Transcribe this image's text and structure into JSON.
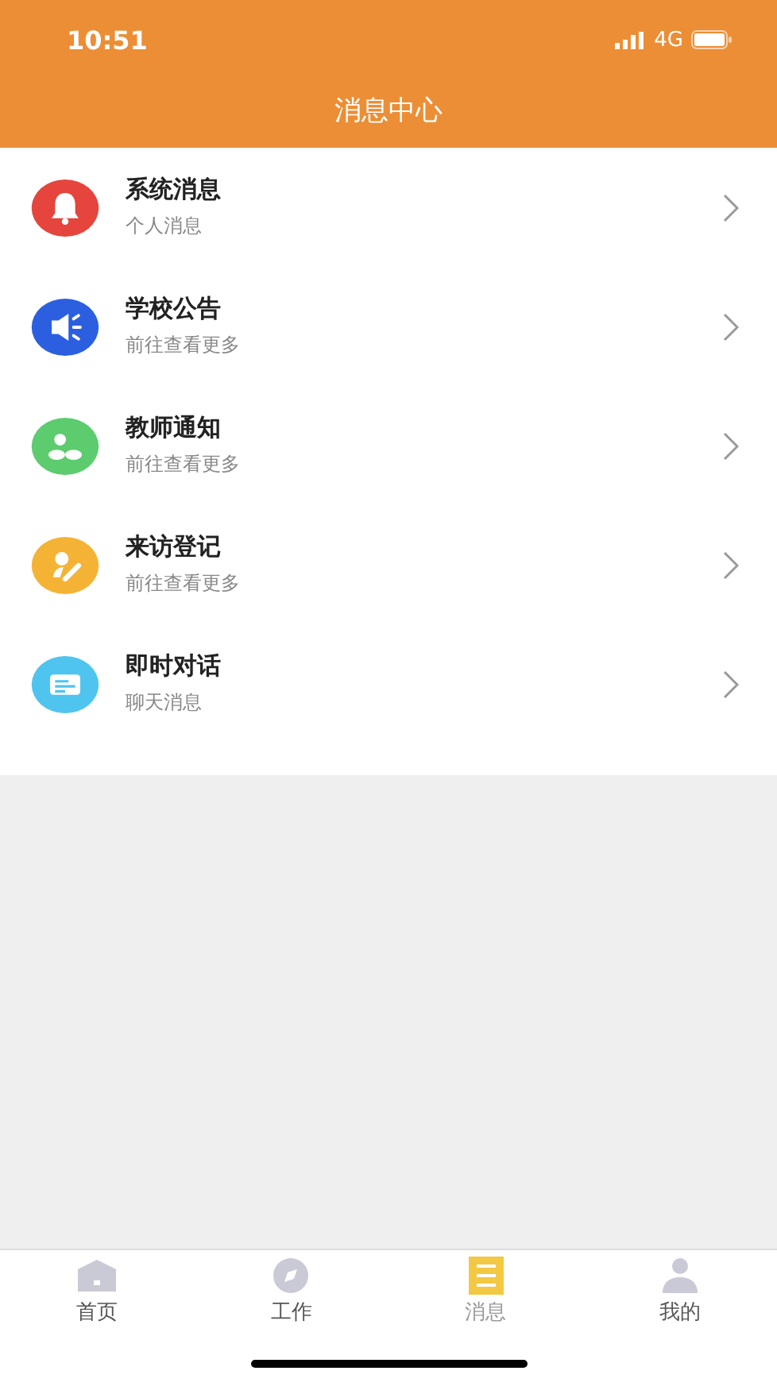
{
  "status_bar": {
    "time": "10:51",
    "network": "4G"
  },
  "header": {
    "title": "消息中心"
  },
  "messages": [
    {
      "kind": "bell",
      "color": "#e5453c",
      "title": "系统消息",
      "subtitle": "个人消息"
    },
    {
      "kind": "speaker",
      "color": "#2b5fe0",
      "title": "学校公告",
      "subtitle": "前往查看更多"
    },
    {
      "kind": "people",
      "color": "#5ccc6e",
      "title": "教师通知",
      "subtitle": "前往查看更多"
    },
    {
      "kind": "pen",
      "color": "#f5b335",
      "title": "来访登记",
      "subtitle": "前往查看更多"
    },
    {
      "kind": "chat",
      "color": "#4fc4ee",
      "title": "即时对话",
      "subtitle": "聊天消息"
    }
  ],
  "tab_bar": [
    {
      "kind": "home",
      "label": "首页",
      "selected": false
    },
    {
      "kind": "compass",
      "label": "工作",
      "selected": false
    },
    {
      "kind": "list",
      "label": "消息",
      "selected": true
    },
    {
      "kind": "person",
      "label": "我的",
      "selected": false
    }
  ]
}
